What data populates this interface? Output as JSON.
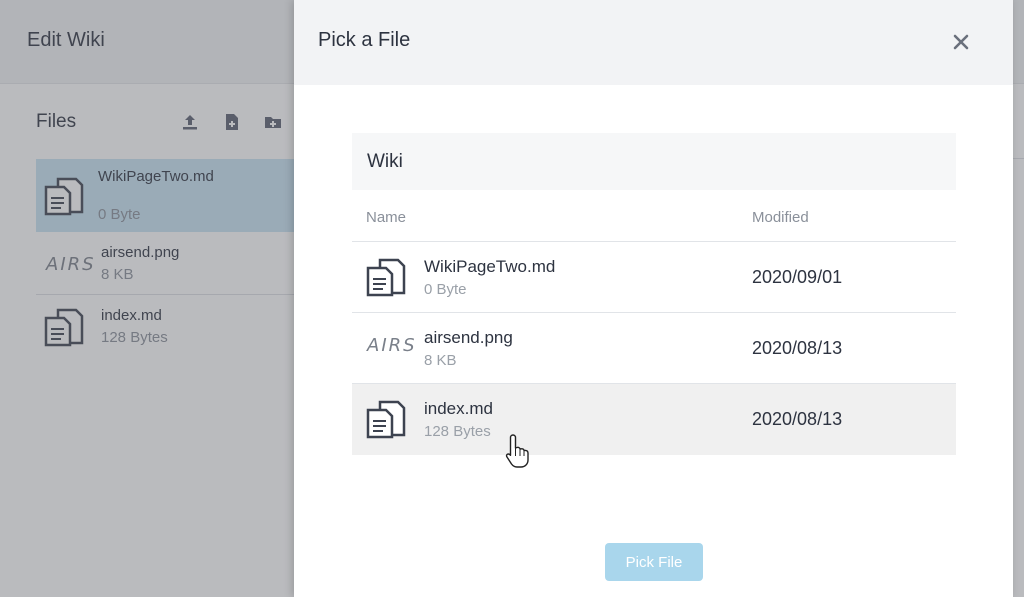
{
  "background": {
    "title": "Edit Wiki",
    "files_title": "Files",
    "toolbar_icons": [
      "upload-icon",
      "new-file-icon",
      "new-folder-icon"
    ],
    "files": [
      {
        "name": "WikiPageTwo.md",
        "size": "0 Byte",
        "icon": "document-icon",
        "selected": true
      },
      {
        "name": "airsend.png",
        "size": "8 KB",
        "icon": "airs-thumbnail"
      },
      {
        "name": "index.md",
        "size": "128 Bytes",
        "icon": "document-icon"
      }
    ]
  },
  "modal": {
    "title": "Pick a File",
    "folder": "Wiki",
    "columns": {
      "name": "Name",
      "modified": "Modified"
    },
    "rows": [
      {
        "name": "WikiPageTwo.md",
        "size": "0 Byte",
        "modified": "2020/09/01",
        "icon": "document-icon"
      },
      {
        "name": "airsend.png",
        "size": "8 KB",
        "modified": "2020/08/13",
        "icon": "airs-thumbnail"
      },
      {
        "name": "index.md",
        "size": "128 Bytes",
        "modified": "2020/08/13",
        "icon": "document-icon"
      }
    ],
    "pick_button": "Pick File",
    "thumb_text": "AIRS"
  },
  "colors": {
    "selected_row": "#c8e4f3",
    "hover_row": "#f0f0f0",
    "button": "#a9d6ec",
    "header_bg": "#f2f3f5"
  }
}
